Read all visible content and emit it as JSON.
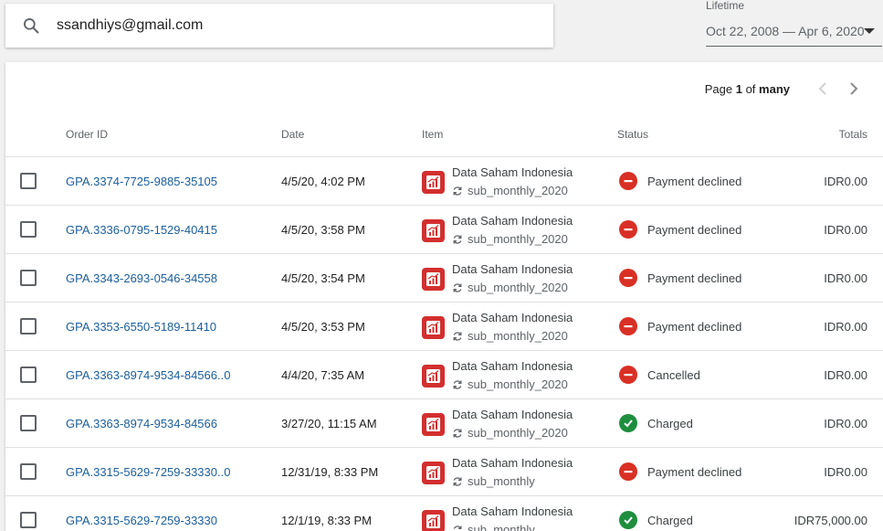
{
  "search": {
    "value": "ssandhiys@gmail.com"
  },
  "filter": {
    "label": "Lifetime",
    "value": "Oct 22, 2008 — Apr 6, 2020"
  },
  "pager": {
    "page_word": "Page",
    "page_num": "1",
    "of_word": "of",
    "total": "many"
  },
  "columns": {
    "order_id": "Order ID",
    "date": "Date",
    "item": "Item",
    "status": "Status",
    "totals": "Totals"
  },
  "colors": {
    "declined": "#d93025",
    "charged": "#1e8e3e",
    "link": "#1a5e9c",
    "app_icon": "#d32f2f"
  },
  "orders": [
    {
      "order_id": "GPA.3374-7725-9885-35105",
      "date": "4/5/20, 4:02 PM",
      "item_name": "Data Saham Indonesia",
      "sku": "sub_monthly_2020",
      "status": "Payment declined",
      "status_type": "declined",
      "total": "IDR0.00"
    },
    {
      "order_id": "GPA.3336-0795-1529-40415",
      "date": "4/5/20, 3:58 PM",
      "item_name": "Data Saham Indonesia",
      "sku": "sub_monthly_2020",
      "status": "Payment declined",
      "status_type": "declined",
      "total": "IDR0.00"
    },
    {
      "order_id": "GPA.3343-2693-0546-34558",
      "date": "4/5/20, 3:54 PM",
      "item_name": "Data Saham Indonesia",
      "sku": "sub_monthly_2020",
      "status": "Payment declined",
      "status_type": "declined",
      "total": "IDR0.00"
    },
    {
      "order_id": "GPA.3353-6550-5189-11410",
      "date": "4/5/20, 3:53 PM",
      "item_name": "Data Saham Indonesia",
      "sku": "sub_monthly_2020",
      "status": "Payment declined",
      "status_type": "declined",
      "total": "IDR0.00"
    },
    {
      "order_id": "GPA.3363-8974-9534-84566..0",
      "date": "4/4/20, 7:35 AM",
      "item_name": "Data Saham Indonesia",
      "sku": "sub_monthly_2020",
      "status": "Cancelled",
      "status_type": "declined",
      "total": "IDR0.00"
    },
    {
      "order_id": "GPA.3363-8974-9534-84566",
      "date": "3/27/20, 11:15 AM",
      "item_name": "Data Saham Indonesia",
      "sku": "sub_monthly_2020",
      "status": "Charged",
      "status_type": "charged",
      "total": "IDR0.00"
    },
    {
      "order_id": "GPA.3315-5629-7259-33330..0",
      "date": "12/31/19, 8:33 PM",
      "item_name": "Data Saham Indonesia",
      "sku": "sub_monthly",
      "status": "Payment declined",
      "status_type": "declined",
      "total": "IDR0.00"
    },
    {
      "order_id": "GPA.3315-5629-7259-33330",
      "date": "12/1/19, 8:33 PM",
      "item_name": "Data Saham Indonesia",
      "sku": "sub_monthly",
      "status": "Charged",
      "status_type": "charged",
      "total": "IDR75,000.00"
    }
  ]
}
